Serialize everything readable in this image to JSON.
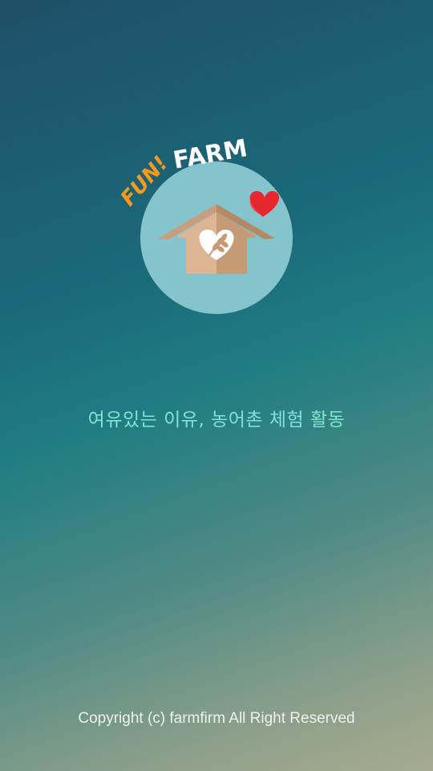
{
  "logo": {
    "word_fun": "FUN!",
    "word_farm": "FARM",
    "icons": [
      "house-icon",
      "heart-icon",
      "wheat-icon"
    ],
    "colors": {
      "circle": "#85c4cd",
      "house_left": "#d9b291",
      "house_right": "#c79a76",
      "fun": "#f39a1e",
      "farm": "#ffffff",
      "hearts": "#e8262d"
    }
  },
  "tagline": "여유있는 이유, 농어촌 체험 활동",
  "copyright": "Copyright (c) farmfirm All Right Reserved"
}
